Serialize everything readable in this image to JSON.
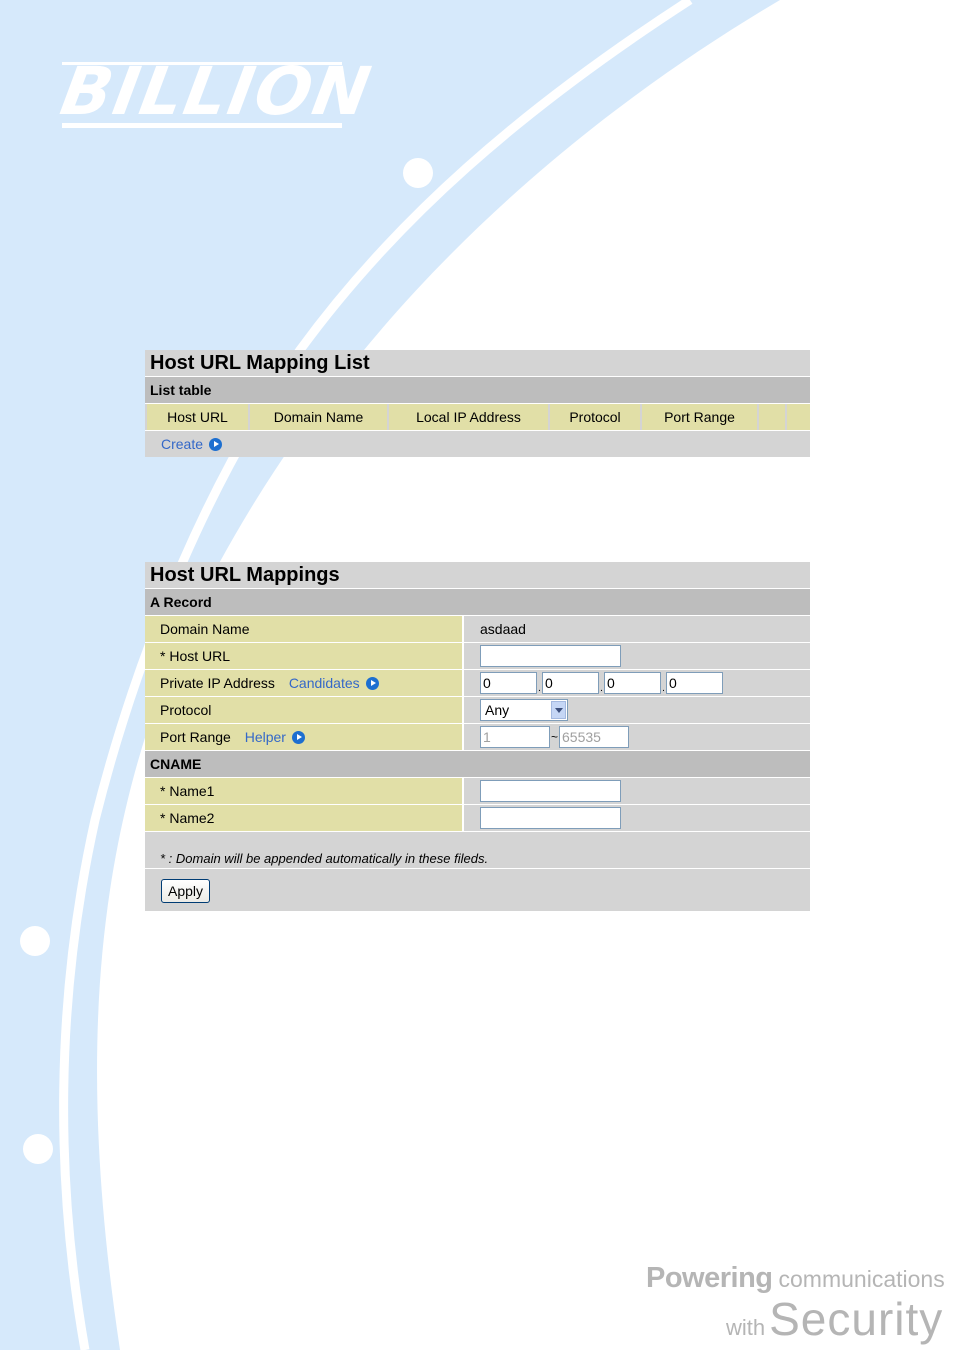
{
  "brand": {
    "logo_text": "BILLION",
    "slogan_powering": "Powering",
    "slogan_communications": "communications",
    "slogan_with": "with",
    "slogan_security": "Security",
    "colors": {
      "background_swoosh": "#d6e9fb",
      "arc_white": "#ffffff",
      "slogan_gray": "#b5b5b5"
    }
  },
  "list_panel": {
    "title": "Host URL Mapping List",
    "section": "List table",
    "columns": [
      "Host URL",
      "Domain Name",
      "Local IP Address",
      "Protocol",
      "Port Range",
      "",
      ""
    ],
    "create_label": "Create",
    "create_icon": "arrow-right-circle-icon"
  },
  "mapping_panel": {
    "title": "Host URL Mappings",
    "a_record": {
      "section": "A Record",
      "domain_name": {
        "label": "Domain Name",
        "value": "asdaad"
      },
      "host_url": {
        "label": "* Host URL",
        "value": ""
      },
      "private_ip": {
        "label": "Private IP Address",
        "link_label": "Candidates",
        "octets": [
          "0",
          "0",
          "0",
          "0"
        ],
        "separator": "."
      },
      "protocol": {
        "label": "Protocol",
        "selected": "Any"
      },
      "port_range": {
        "label": "Port Range",
        "link_label": "Helper",
        "start": "1",
        "separator": "~",
        "end": "65535"
      }
    },
    "cname": {
      "section": "CNAME",
      "name1": {
        "label": "* Name1",
        "value": ""
      },
      "name2": {
        "label": "* Name2",
        "value": ""
      }
    },
    "note": "* : Domain will be appended automatically in these fileds.",
    "apply_label": "Apply"
  }
}
